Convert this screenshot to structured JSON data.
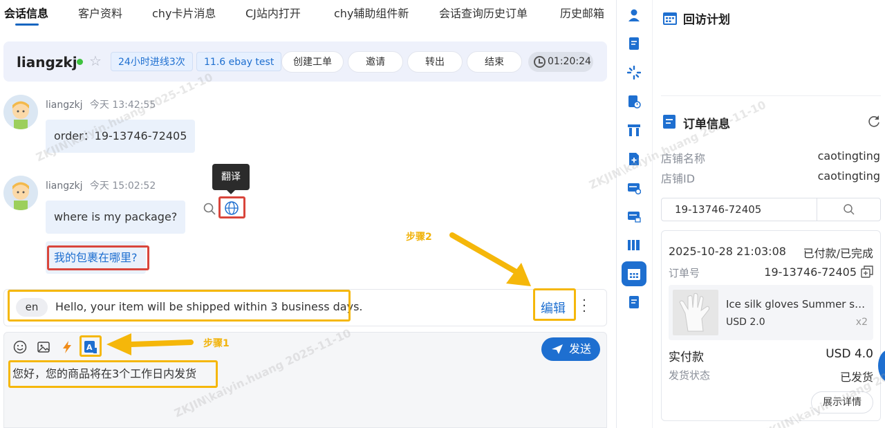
{
  "tabs": [
    "会话信息",
    "客户资料",
    "chy卡片消息",
    "CJ站内打开",
    "chy辅助组件新",
    "会话查询历史订单",
    "历史邮箱"
  ],
  "header": {
    "username": "liangzkj",
    "chips": [
      "24小时进线3次",
      "11.6 ebay test"
    ],
    "buttons": [
      "创建工单",
      "邀请",
      "转出",
      "结束"
    ],
    "timer": "01:20:24"
  },
  "messages": [
    {
      "name": "liangzkj",
      "time": "今天 13:42:55",
      "text": "order：19-13746-72405"
    },
    {
      "name": "liangzkj",
      "time": "今天 15:02:52",
      "text": "where is my package?",
      "translation": "我的包裹在哪里?"
    }
  ],
  "tooltip": "翻译",
  "translate_row": {
    "lang": "en",
    "text": "Hello, your item will be shipped within 3 business days.",
    "edit_label": "编辑"
  },
  "compose": {
    "text": "您好，您的商品将在3个工作日内发货",
    "send_label": "发送"
  },
  "annotations": {
    "step1": "步骤1",
    "step2": "步骤2"
  },
  "watermark": "ZKJIN\\kaiyin.huang  2025-11-10",
  "right_panel": {
    "visit_plan_title": "回访计划",
    "order_info_title": "订单信息",
    "store_name_label": "店铺名称",
    "store_name_value": "caotingting",
    "store_id_label": "店铺ID",
    "store_id_value": "caotingting",
    "search_value": "19-13746-72405",
    "order": {
      "date": "2025-10-28 21:03:08",
      "status": "已付款/已完成",
      "order_no_label": "订单号",
      "order_no": "19-13746-72405",
      "product_name": "Ice silk gloves Summer sun protection",
      "product_price": "USD 2.0",
      "product_qty": "x2",
      "paid_label": "实付款",
      "paid_value": "USD 4.0",
      "ship_label": "发货状态",
      "ship_value": "已发货",
      "detail_button": "展示详情"
    }
  },
  "colors": {
    "accent": "#1e6fd0",
    "highlight_yellow": "#f5b70a",
    "highlight_red": "#d9453b"
  }
}
